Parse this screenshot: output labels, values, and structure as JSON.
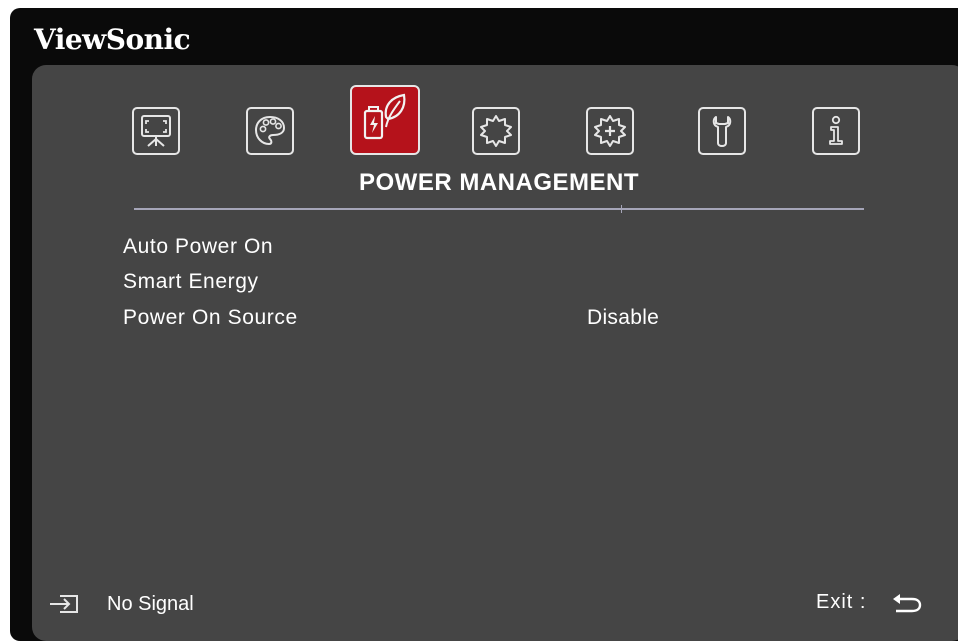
{
  "brand": "ViewSonic",
  "tabs": [
    {
      "name": "display-icon",
      "active": false
    },
    {
      "name": "palette-icon",
      "active": false
    },
    {
      "name": "power-management-icon",
      "active": true
    },
    {
      "name": "basic-settings-icon",
      "active": false
    },
    {
      "name": "advanced-settings-icon",
      "active": false
    },
    {
      "name": "system-icon",
      "active": false
    },
    {
      "name": "information-icon",
      "active": false
    }
  ],
  "menu": {
    "title": "POWER MANAGEMENT",
    "items": [
      {
        "label": "Auto Power On",
        "value": ""
      },
      {
        "label": "Smart Energy",
        "value": ""
      },
      {
        "label": "Power On Source",
        "value": "Disable"
      }
    ]
  },
  "footer": {
    "signal": "No Signal",
    "exit": "Exit :"
  },
  "colors": {
    "accent": "#b5121b",
    "panel": "#454545",
    "frame": "#0a0a0a"
  }
}
